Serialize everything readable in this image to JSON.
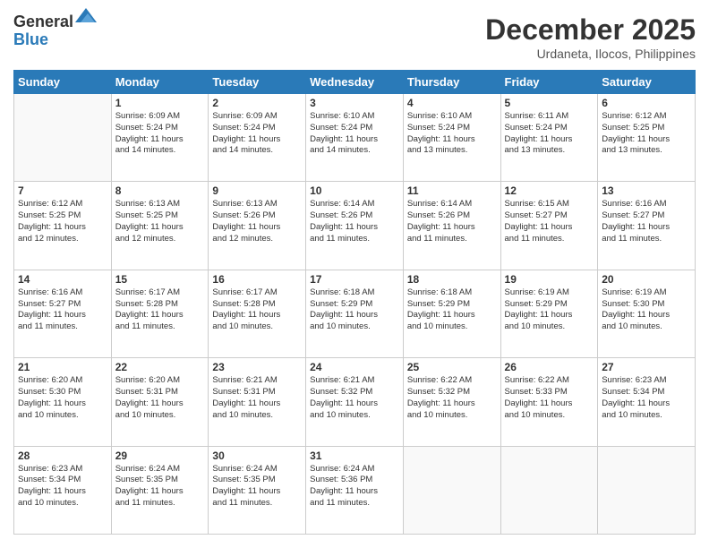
{
  "logo": {
    "general": "General",
    "blue": "Blue"
  },
  "title": "December 2025",
  "location": "Urdaneta, Ilocos, Philippines",
  "weekdays": [
    "Sunday",
    "Monday",
    "Tuesday",
    "Wednesday",
    "Thursday",
    "Friday",
    "Saturday"
  ],
  "weeks": [
    [
      {
        "day": "",
        "info": ""
      },
      {
        "day": "1",
        "info": "Sunrise: 6:09 AM\nSunset: 5:24 PM\nDaylight: 11 hours\nand 14 minutes."
      },
      {
        "day": "2",
        "info": "Sunrise: 6:09 AM\nSunset: 5:24 PM\nDaylight: 11 hours\nand 14 minutes."
      },
      {
        "day": "3",
        "info": "Sunrise: 6:10 AM\nSunset: 5:24 PM\nDaylight: 11 hours\nand 14 minutes."
      },
      {
        "day": "4",
        "info": "Sunrise: 6:10 AM\nSunset: 5:24 PM\nDaylight: 11 hours\nand 13 minutes."
      },
      {
        "day": "5",
        "info": "Sunrise: 6:11 AM\nSunset: 5:24 PM\nDaylight: 11 hours\nand 13 minutes."
      },
      {
        "day": "6",
        "info": "Sunrise: 6:12 AM\nSunset: 5:25 PM\nDaylight: 11 hours\nand 13 minutes."
      }
    ],
    [
      {
        "day": "7",
        "info": "Sunrise: 6:12 AM\nSunset: 5:25 PM\nDaylight: 11 hours\nand 12 minutes."
      },
      {
        "day": "8",
        "info": "Sunrise: 6:13 AM\nSunset: 5:25 PM\nDaylight: 11 hours\nand 12 minutes."
      },
      {
        "day": "9",
        "info": "Sunrise: 6:13 AM\nSunset: 5:26 PM\nDaylight: 11 hours\nand 12 minutes."
      },
      {
        "day": "10",
        "info": "Sunrise: 6:14 AM\nSunset: 5:26 PM\nDaylight: 11 hours\nand 11 minutes."
      },
      {
        "day": "11",
        "info": "Sunrise: 6:14 AM\nSunset: 5:26 PM\nDaylight: 11 hours\nand 11 minutes."
      },
      {
        "day": "12",
        "info": "Sunrise: 6:15 AM\nSunset: 5:27 PM\nDaylight: 11 hours\nand 11 minutes."
      },
      {
        "day": "13",
        "info": "Sunrise: 6:16 AM\nSunset: 5:27 PM\nDaylight: 11 hours\nand 11 minutes."
      }
    ],
    [
      {
        "day": "14",
        "info": "Sunrise: 6:16 AM\nSunset: 5:27 PM\nDaylight: 11 hours\nand 11 minutes."
      },
      {
        "day": "15",
        "info": "Sunrise: 6:17 AM\nSunset: 5:28 PM\nDaylight: 11 hours\nand 11 minutes."
      },
      {
        "day": "16",
        "info": "Sunrise: 6:17 AM\nSunset: 5:28 PM\nDaylight: 11 hours\nand 10 minutes."
      },
      {
        "day": "17",
        "info": "Sunrise: 6:18 AM\nSunset: 5:29 PM\nDaylight: 11 hours\nand 10 minutes."
      },
      {
        "day": "18",
        "info": "Sunrise: 6:18 AM\nSunset: 5:29 PM\nDaylight: 11 hours\nand 10 minutes."
      },
      {
        "day": "19",
        "info": "Sunrise: 6:19 AM\nSunset: 5:29 PM\nDaylight: 11 hours\nand 10 minutes."
      },
      {
        "day": "20",
        "info": "Sunrise: 6:19 AM\nSunset: 5:30 PM\nDaylight: 11 hours\nand 10 minutes."
      }
    ],
    [
      {
        "day": "21",
        "info": "Sunrise: 6:20 AM\nSunset: 5:30 PM\nDaylight: 11 hours\nand 10 minutes."
      },
      {
        "day": "22",
        "info": "Sunrise: 6:20 AM\nSunset: 5:31 PM\nDaylight: 11 hours\nand 10 minutes."
      },
      {
        "day": "23",
        "info": "Sunrise: 6:21 AM\nSunset: 5:31 PM\nDaylight: 11 hours\nand 10 minutes."
      },
      {
        "day": "24",
        "info": "Sunrise: 6:21 AM\nSunset: 5:32 PM\nDaylight: 11 hours\nand 10 minutes."
      },
      {
        "day": "25",
        "info": "Sunrise: 6:22 AM\nSunset: 5:32 PM\nDaylight: 11 hours\nand 10 minutes."
      },
      {
        "day": "26",
        "info": "Sunrise: 6:22 AM\nSunset: 5:33 PM\nDaylight: 11 hours\nand 10 minutes."
      },
      {
        "day": "27",
        "info": "Sunrise: 6:23 AM\nSunset: 5:34 PM\nDaylight: 11 hours\nand 10 minutes."
      }
    ],
    [
      {
        "day": "28",
        "info": "Sunrise: 6:23 AM\nSunset: 5:34 PM\nDaylight: 11 hours\nand 10 minutes."
      },
      {
        "day": "29",
        "info": "Sunrise: 6:24 AM\nSunset: 5:35 PM\nDaylight: 11 hours\nand 11 minutes."
      },
      {
        "day": "30",
        "info": "Sunrise: 6:24 AM\nSunset: 5:35 PM\nDaylight: 11 hours\nand 11 minutes."
      },
      {
        "day": "31",
        "info": "Sunrise: 6:24 AM\nSunset: 5:36 PM\nDaylight: 11 hours\nand 11 minutes."
      },
      {
        "day": "",
        "info": ""
      },
      {
        "day": "",
        "info": ""
      },
      {
        "day": "",
        "info": ""
      }
    ]
  ]
}
